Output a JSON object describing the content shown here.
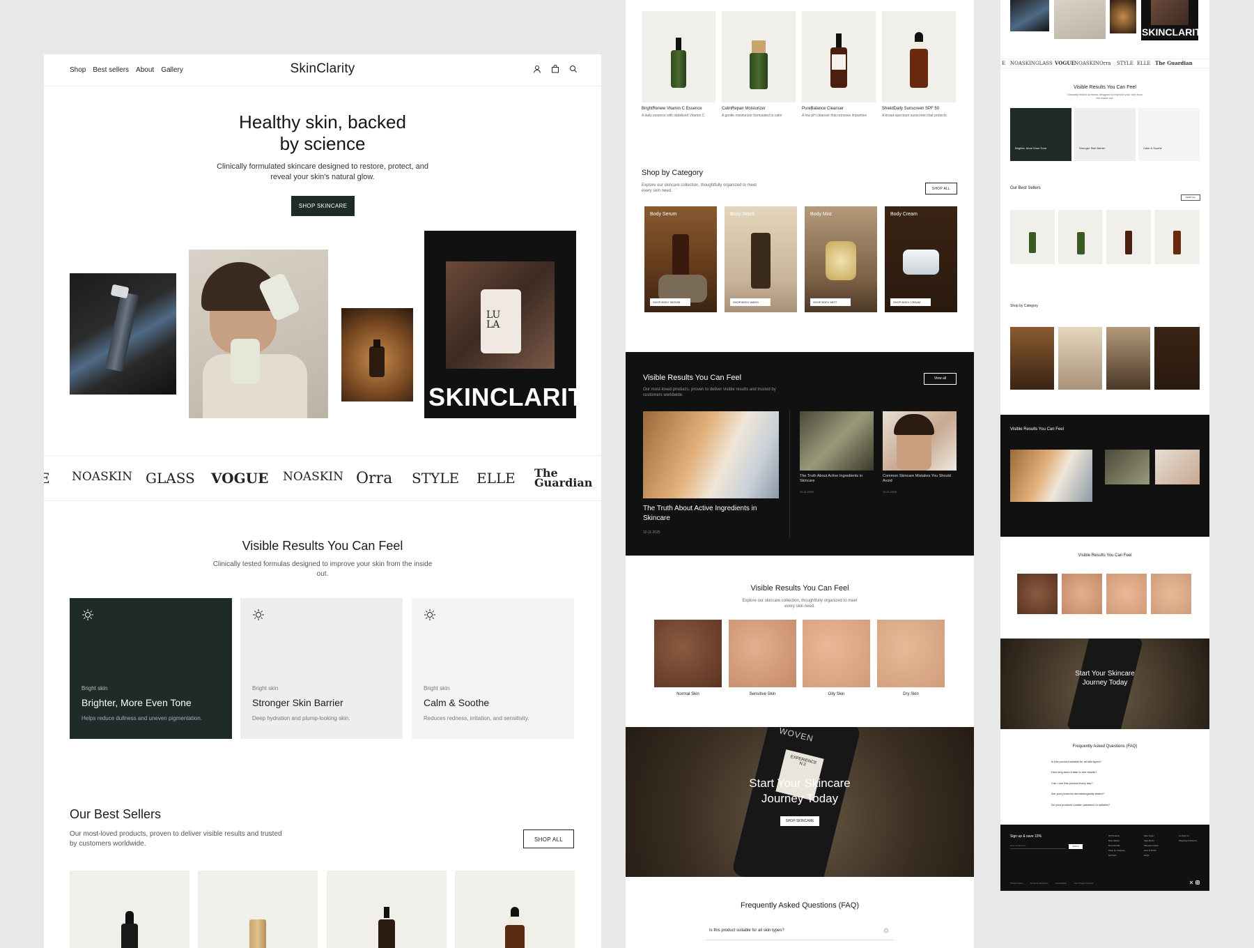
{
  "brand": "SkinClarity",
  "nav": {
    "links": [
      "Shop",
      "Best sellers",
      "About",
      "Gallery"
    ]
  },
  "hero": {
    "title_line1": "Healthy skin, backed",
    "title_line2": "by science",
    "subtitle": "Clinically formulated skincare designed to restore, protect, and reveal your skin's natural glow.",
    "cta": "SHOP SKINCARE",
    "overlay_word": "SKINCLARITY",
    "bottle_text": "LU LA"
  },
  "press_logos": [
    "E",
    "NOASKIN",
    "GLASS",
    "VOGUE",
    "NOASKIN",
    "Orra",
    "STYLE",
    "ELLE",
    "The Guardian"
  ],
  "results": {
    "title": "Visible Results You Can Feel",
    "subtitle": "Clinically tested formulas designed to improve your skin from the inside out.",
    "cards": [
      {
        "tag": "Bright skin",
        "title": "Brighter, More Even Tone",
        "desc": "Helps reduce dullness and uneven pigmentation."
      },
      {
        "tag": "Bright skin",
        "title": "Stronger Skin Barrier",
        "desc": "Deep hydration and plump-looking skin."
      },
      {
        "tag": "Bright skin",
        "title": "Calm & Soothe",
        "desc": "Reduces redness, irritation, and sensitivity."
      }
    ]
  },
  "best_sellers": {
    "title": "Our Best Sellers",
    "subtitle": "Our most-loved products, proven to deliver visible results and trusted by customers worldwide.",
    "cta": "SHOP ALL"
  },
  "products": [
    {
      "name": "BrightRenew Vitamin C Essence",
      "desc": "A daily essence with stabilized Vitamin C"
    },
    {
      "name": "CalmRepair Moisturizer",
      "desc": "A gentle moisturizer formulated to calm"
    },
    {
      "name": "PureBalance Cleanser",
      "desc": "A low pH cleanser that removes impurities"
    },
    {
      "name": "ShieldDaily Sunscreen SPF 50",
      "desc": "A broad-spectrum sunscreen that protects"
    }
  ],
  "categories": {
    "title": "Shop by Category",
    "subtitle": "Explore our skincare collection, thoughtfully organized to meet every skin need.",
    "cta": "SHOP ALL",
    "items": [
      {
        "label": "Body Serum",
        "button": "SHOP BODY SERUM"
      },
      {
        "label": "Body Wash",
        "button": "SHOP BODY WASH"
      },
      {
        "label": "Body Mist",
        "button": "SHOP BODY MIST"
      },
      {
        "label": "Body Cream",
        "button": "SHOP BODY CREAM"
      }
    ]
  },
  "journal": {
    "title": "Visible Results You Can Feel",
    "subtitle": "Our most-loved products, proven to deliver visible results and trusted by customers worldwide.",
    "cta": "View all",
    "posts": [
      {
        "title": "The Truth About Active Ingredients in Skincare",
        "date": "10.11.2025"
      },
      {
        "title": "The Truth About Active Ingredients in Skincare",
        "date": "10.11.2025"
      },
      {
        "title": "Common Skincare Mistakes You Should Avoid",
        "date": "10.11.2025"
      }
    ]
  },
  "skin_types": {
    "title": "Visible Results You Can Feel",
    "subtitle": "Explore our skincare collection, thoughtfully organized to meet every skin need.",
    "items": [
      "Normal Skin",
      "Sensitive Skin",
      "Oily Skin",
      "Dry Skin"
    ]
  },
  "banner": {
    "title_line1": "Start Your Skincare",
    "title_line2": "Journey Today",
    "cta": "SHOP SKINCARE",
    "bottle_brand": "WOVEN",
    "bottle_label": "EXPERIENCE N.3"
  },
  "faq": {
    "title": "Frequently Asked Questions (FAQ)",
    "items": [
      "Is this product suitable for all skin types?",
      "How long does it take to see results?",
      "Can I use this product every day?",
      "Are your products dermatologically tested?",
      "Do your products contain parabens or sulfates?"
    ]
  },
  "footer": {
    "signup": "Sign up & save 10%",
    "email_placeholder": "Enter Email Here",
    "signup_button": "Submit",
    "col1": [
      "All Products",
      "Best Sellers",
      "New Arrivals",
      "Shop by Category",
      "Gift Sets"
    ],
    "col2": [
      "Skin Types",
      "Ingredients",
      "Skincare Guide",
      "How It Works",
      "FAQs"
    ],
    "col3": [
      "Contact Us",
      "Shipping & Returns"
    ],
    "legal": [
      "Privacy Policy",
      "Terms & Conditions",
      "Accessibility",
      "Your Privacy Choices"
    ]
  },
  "colors": {
    "dark_green": "#1e2b29",
    "tile": "#f1efea",
    "black": "#111111"
  }
}
